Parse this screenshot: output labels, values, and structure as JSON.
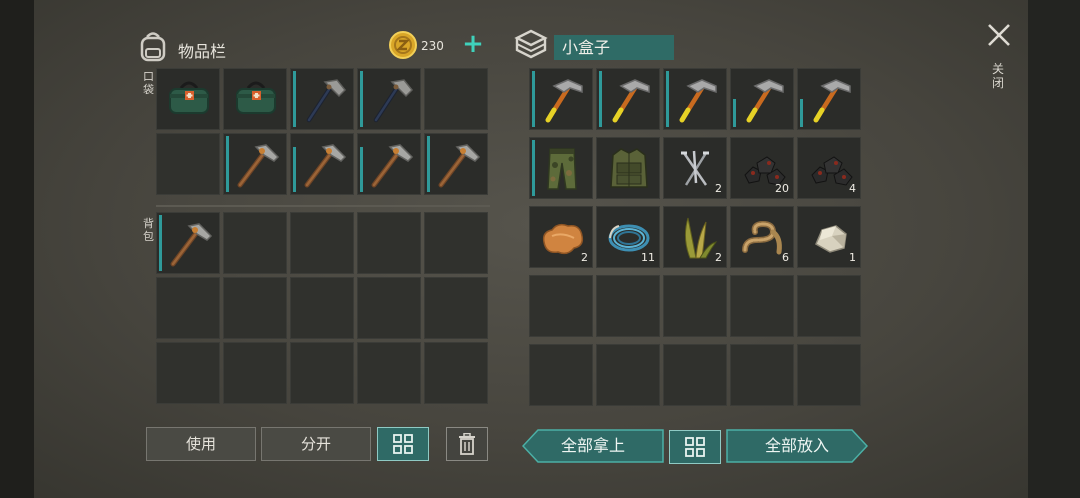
{
  "inventory": {
    "title": "物品栏",
    "coins": "230",
    "plus": "+",
    "pocket_label": "口袋",
    "backpack_label": "背包",
    "pocket_slots": [
      {
        "item": "medkit-icon",
        "bar": 0,
        "qty": ""
      },
      {
        "item": "medkit-icon",
        "bar": 0,
        "qty": ""
      },
      {
        "item": "stone-hatchet-icon",
        "bar": 1,
        "qty": ""
      },
      {
        "item": "stone-hatchet-icon",
        "bar": 1,
        "qty": ""
      },
      {
        "item": "",
        "bar": 0,
        "qty": ""
      },
      {
        "item": "",
        "bar": 0,
        "qty": ""
      },
      {
        "item": "pickaxe-icon",
        "bar": 1,
        "qty": ""
      },
      {
        "item": "pickaxe-icon",
        "bar": 0.8,
        "qty": ""
      },
      {
        "item": "pickaxe-icon",
        "bar": 0.8,
        "qty": ""
      },
      {
        "item": "pickaxe-icon",
        "bar": 1,
        "qty": ""
      }
    ],
    "backpack_slots": [
      {
        "item": "pickaxe-icon",
        "bar": 1,
        "qty": ""
      },
      {
        "item": "",
        "bar": 0,
        "qty": ""
      },
      {
        "item": "",
        "bar": 0,
        "qty": ""
      },
      {
        "item": "",
        "bar": 0,
        "qty": ""
      },
      {
        "item": "",
        "bar": 0,
        "qty": ""
      },
      {
        "item": "",
        "bar": 0,
        "qty": ""
      },
      {
        "item": "",
        "bar": 0,
        "qty": ""
      },
      {
        "item": "",
        "bar": 0,
        "qty": ""
      },
      {
        "item": "",
        "bar": 0,
        "qty": ""
      },
      {
        "item": "",
        "bar": 0,
        "qty": ""
      },
      {
        "item": "",
        "bar": 0,
        "qty": ""
      },
      {
        "item": "",
        "bar": 0,
        "qty": ""
      },
      {
        "item": "",
        "bar": 0,
        "qty": ""
      },
      {
        "item": "",
        "bar": 0,
        "qty": ""
      },
      {
        "item": "",
        "bar": 0,
        "qty": ""
      }
    ],
    "buttons": {
      "use": "使用",
      "split": "分开"
    }
  },
  "box": {
    "title": "小盒子",
    "slots": [
      {
        "item": "hammer-icon",
        "bar": 1,
        "qty": ""
      },
      {
        "item": "hammer-icon",
        "bar": 1,
        "qty": ""
      },
      {
        "item": "hammer-icon",
        "bar": 1,
        "qty": ""
      },
      {
        "item": "hammer-icon",
        "bar": 0.5,
        "qty": ""
      },
      {
        "item": "hammer-icon",
        "bar": 0.5,
        "qty": ""
      },
      {
        "item": "camo-pants-icon",
        "bar": 1,
        "qty": ""
      },
      {
        "item": "tactical-vest-icon",
        "bar": 0,
        "qty": ""
      },
      {
        "item": "nails-icon",
        "bar": 0,
        "qty": "2"
      },
      {
        "item": "coal-icon",
        "bar": 0,
        "qty": "20"
      },
      {
        "item": "coal-icon",
        "bar": 0,
        "qty": "4"
      },
      {
        "item": "leather-icon",
        "bar": 0,
        "qty": "2"
      },
      {
        "item": "wire-coil-icon",
        "bar": 0,
        "qty": "11"
      },
      {
        "item": "plant-fiber-icon",
        "bar": 0,
        "qty": "2"
      },
      {
        "item": "rope-icon",
        "bar": 0,
        "qty": "6"
      },
      {
        "item": "stone-icon",
        "bar": 0,
        "qty": "1"
      },
      {
        "item": "",
        "bar": 0,
        "qty": ""
      },
      {
        "item": "",
        "bar": 0,
        "qty": ""
      },
      {
        "item": "",
        "bar": 0,
        "qty": ""
      },
      {
        "item": "",
        "bar": 0,
        "qty": ""
      },
      {
        "item": "",
        "bar": 0,
        "qty": ""
      },
      {
        "item": "",
        "bar": 0,
        "qty": ""
      },
      {
        "item": "",
        "bar": 0,
        "qty": ""
      },
      {
        "item": "",
        "bar": 0,
        "qty": ""
      },
      {
        "item": "",
        "bar": 0,
        "qty": ""
      },
      {
        "item": "",
        "bar": 0,
        "qty": ""
      }
    ],
    "buttons": {
      "take_all": "全部拿上",
      "put_all": "全部放入"
    }
  },
  "close_label": "关闭",
  "colors": {
    "accent": "#2f6a66",
    "bar": "#2f9a9a",
    "plus": "#3fd1bb"
  }
}
